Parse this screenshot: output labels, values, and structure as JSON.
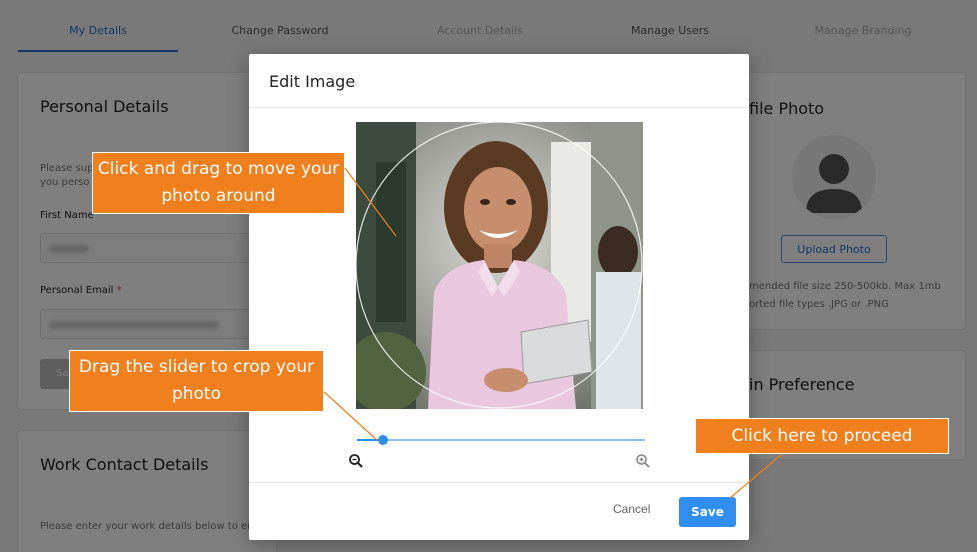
{
  "tabs": [
    {
      "label": "My Details"
    },
    {
      "label": "Change Password"
    },
    {
      "label": "Account Details"
    },
    {
      "label": "Manage Users"
    },
    {
      "label": "Manage Branding"
    }
  ],
  "personal": {
    "title": "Personal Details",
    "hint": "Please sup",
    "hint2": "you perso",
    "first_name_label": "First Name",
    "email_label": "Personal Email",
    "required_mark": "*",
    "save_button_label": "Sa"
  },
  "work": {
    "title": "Work Contact Details",
    "hint": "Please enter your work details below to en"
  },
  "profile": {
    "title": "file Photo",
    "upload_label": "Upload Photo",
    "note1": "mended file size 250-500kb. Max 1mb",
    "note2": "orted file types .JPG or .PNG"
  },
  "login": {
    "title": "in Preference"
  },
  "modal": {
    "title": "Edit Image",
    "cancel_label": "Cancel",
    "save_label": "Save",
    "zoom_position": 0.09
  },
  "callouts": {
    "move": "Click and drag to move your photo around",
    "crop": "Drag the slider to crop your photo",
    "proceed": "Click here to proceed"
  },
  "colors": {
    "accent": "#2f8ef0",
    "callout": "#f07f1e",
    "tab_active": "#2b6fd1"
  }
}
